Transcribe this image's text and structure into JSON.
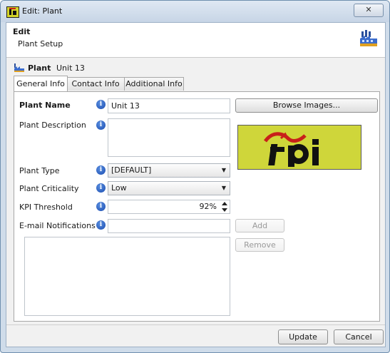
{
  "window": {
    "title": "Edit: Plant",
    "close_glyph": "✕"
  },
  "header": {
    "title": "Edit",
    "subtitle": "Plant Setup"
  },
  "plant_line": {
    "label": "Plant",
    "value": "Unit 13"
  },
  "tabs": [
    {
      "label": "General Info",
      "active": true
    },
    {
      "label": "Contact Info",
      "active": false
    },
    {
      "label": "Additional Info",
      "active": false
    }
  ],
  "form": {
    "plant_name": {
      "label": "Plant Name",
      "value": "Unit 13"
    },
    "plant_description": {
      "label": "Plant Description",
      "value": ""
    },
    "plant_type": {
      "label": "Plant Type",
      "value": "[DEFAULT]"
    },
    "plant_criticality": {
      "label": "Plant Criticality",
      "value": "Low"
    },
    "kpi_threshold": {
      "label": "KPI Threshold",
      "value": "92%"
    },
    "email_notifications": {
      "label": "E-mail Notifications",
      "value": ""
    }
  },
  "buttons": {
    "browse_images": "Browse Images...",
    "add": "Add",
    "remove": "Remove",
    "update": "Update",
    "cancel": "Cancel"
  },
  "logo": {
    "text": "fpi"
  },
  "icons": {
    "app": "fpi-app-icon",
    "header": "factory-icon",
    "plant": "factory-icon",
    "info": "info-icon"
  },
  "colors": {
    "logo_background": "#cfd63a",
    "logo_accent": "#c8201a",
    "info_icon": "#1a4cb0",
    "window_frame": "#cfdcea"
  }
}
